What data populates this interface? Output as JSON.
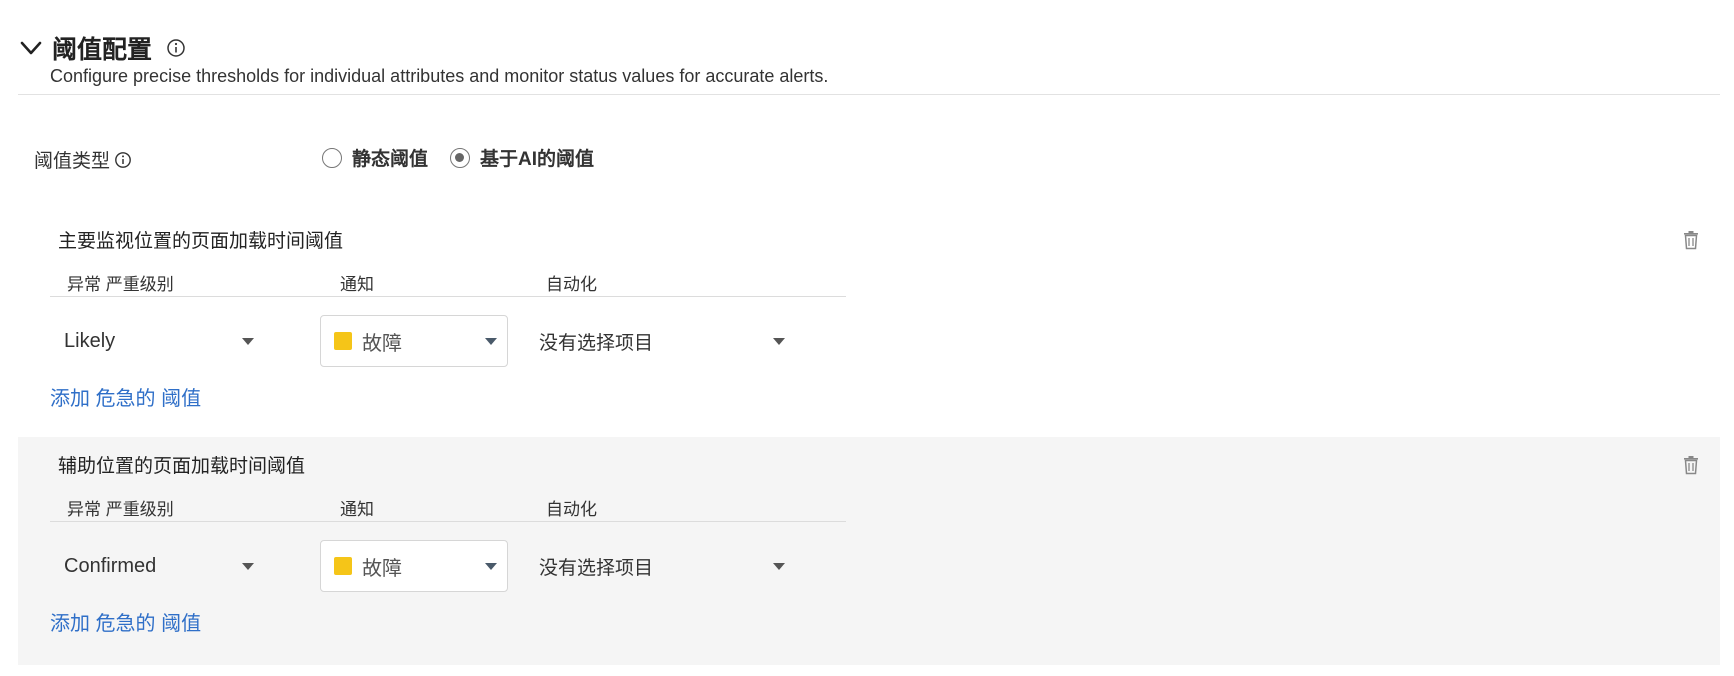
{
  "section": {
    "title": "阈值配置",
    "description": "Configure precise thresholds for individual attributes and monitor status values for accurate alerts."
  },
  "threshold_type": {
    "label": "阈值类型",
    "options": [
      {
        "label": "静态阈值",
        "selected": false
      },
      {
        "label": "基于AI的阈值",
        "selected": true
      }
    ]
  },
  "columns": {
    "severity": "异常 严重级别",
    "notification": "通知",
    "automation": "自动化"
  },
  "cards": [
    {
      "title": "主要监视位置的页面加载时间阈值",
      "severity": "Likely",
      "notification": "故障",
      "notification_color": "#f5c518",
      "automation": "没有选择项目",
      "add_link": "添加 危急的 阈值"
    },
    {
      "title": "辅助位置的页面加载时间阈值",
      "severity": "Confirmed",
      "notification": "故障",
      "notification_color": "#f5c518",
      "automation": "没有选择项目",
      "add_link": "添加 危急的 阈值"
    }
  ],
  "icons": {
    "collapse": "chevron-down-icon",
    "info": "info-icon",
    "delete": "trash-icon"
  },
  "colors": {
    "link": "#2f6fc8",
    "alt_row_bg": "#f5f5f5",
    "trouble_status": "#f5c518"
  }
}
